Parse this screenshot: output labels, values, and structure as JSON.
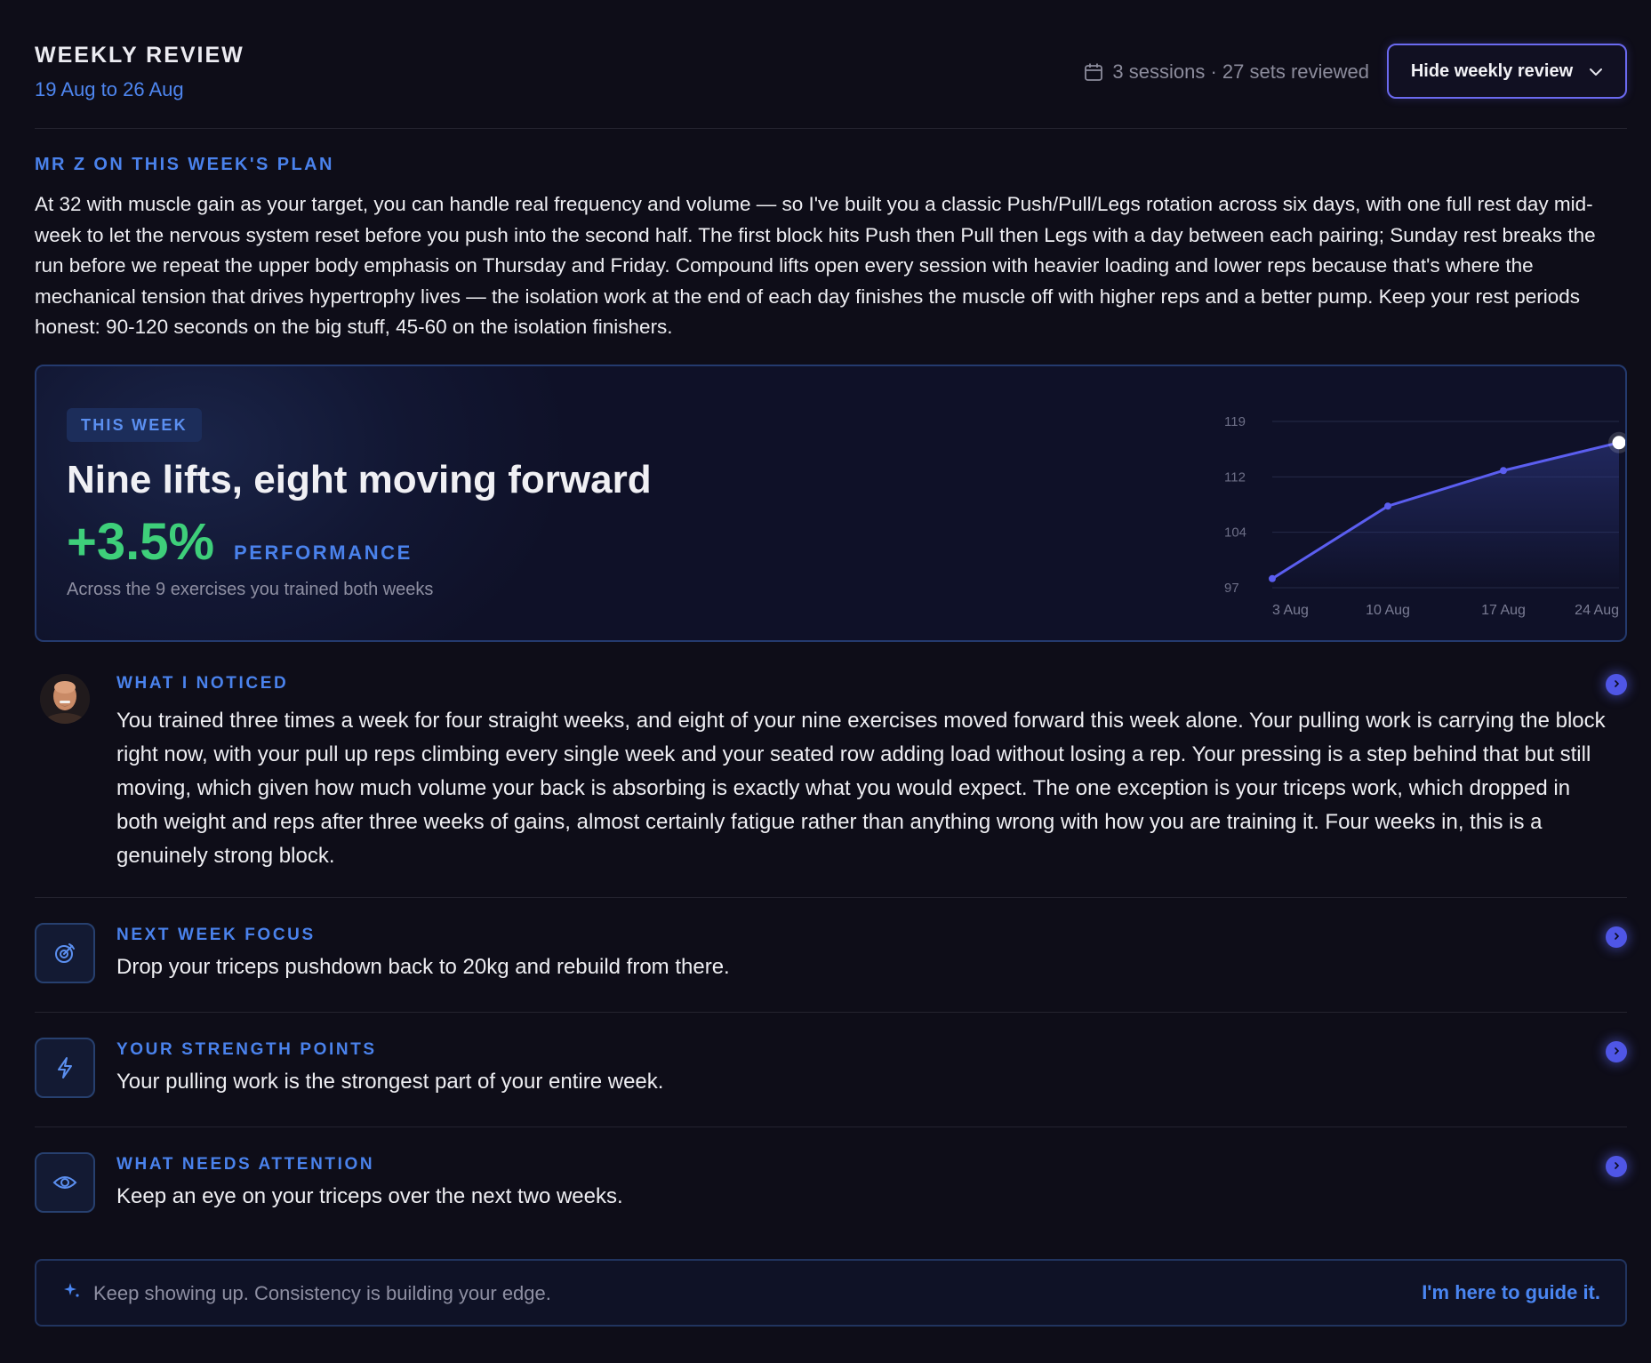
{
  "header": {
    "title": "WEEKLY REVIEW",
    "date_range": "19 Aug to 26 Aug",
    "meta": "3 sessions · 27 sets reviewed",
    "hide_button": "Hide weekly review"
  },
  "plan": {
    "label": "MR Z ON THIS WEEK'S PLAN",
    "text": "At 32 with muscle gain as your target, you can handle real frequency and volume — so I've built you a classic Push/Pull/Legs rotation across six days, with one full rest day mid-week to let the nervous system reset before you push into the second half. The first block hits Push then Pull then Legs with a day between each pairing; Sunday rest breaks the run before we repeat the upper body emphasis on Thursday and Friday. Compound lifts open every session with heavier loading and lower reps because that's where the mechanical tension that drives hypertrophy lives — the isolation work at the end of each day finishes the muscle off with higher reps and a better pump. Keep your rest periods honest: 90-120 seconds on the big stuff, 45-60 on the isolation finishers."
  },
  "hero": {
    "pill": "THIS WEEK",
    "title": "Nine lifts, eight moving forward",
    "percent": "+3.5%",
    "percent_label": "PERFORMANCE",
    "subtitle": "Across the 9 exercises you trained both weeks",
    "accent_color": "#3ecf7a"
  },
  "chart_data": {
    "type": "area",
    "x": [
      "3 Aug",
      "10 Aug",
      "17 Aug",
      "24 Aug"
    ],
    "values": [
      98.2,
      107.8,
      112.5,
      116.2
    ],
    "yticks": [
      "119",
      "112",
      "104",
      "97"
    ],
    "ylim": [
      97,
      119
    ],
    "grid": true,
    "line_color": "#5b5ef0"
  },
  "insights": [
    {
      "label": "WHAT I NOTICED",
      "text": "You trained three times a week for four straight weeks, and eight of your nine exercises moved forward this week alone. Your pulling work is carrying the block right now, with your pull up reps climbing every single week and your seated row adding load without losing a rep. Your pressing is a step behind that but still moving, which given how much volume your back is absorbing is exactly what you would expect. The one exception is your triceps work, which dropped in both weight and reps after three weeks of gains, almost certainly fatigue rather than anything wrong with how you are training it. Four weeks in, this is a genuinely strong block.",
      "icon": "coach-avatar"
    },
    {
      "label": "NEXT WEEK FOCUS",
      "text": "Drop your triceps pushdown back to 20kg and rebuild from there.",
      "icon": "target-icon"
    },
    {
      "label": "YOUR STRENGTH POINTS",
      "text": "Your pulling work is the strongest part of your entire week.",
      "icon": "bolt-icon"
    },
    {
      "label": "WHAT NEEDS ATTENTION",
      "text": "Keep an eye on your triceps over the next two weeks.",
      "icon": "eye-icon"
    }
  ],
  "footer": {
    "text": "Keep showing up. Consistency is building your edge.",
    "link": "I'm here to guide it."
  }
}
